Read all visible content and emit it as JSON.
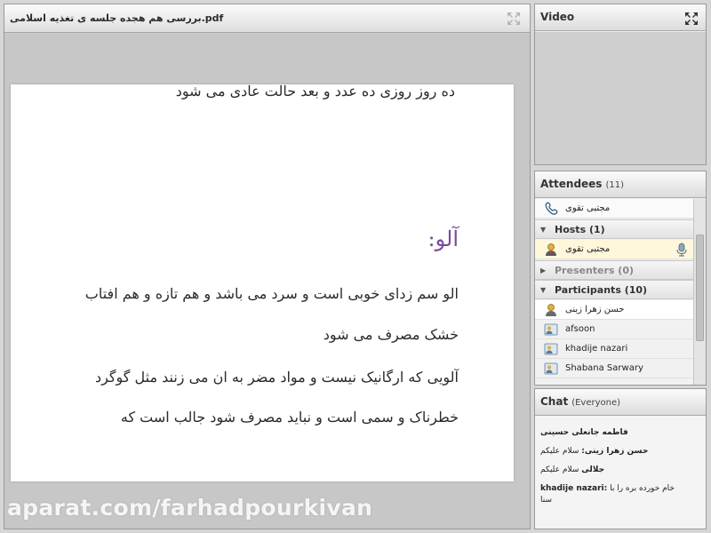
{
  "document": {
    "title": "بررسی هم هجده جلسه ی تغذیه اسلامی.pdf",
    "lines": {
      "top": "ده روز روزی ده عدد و بعد  حالت عادی می شود",
      "heading": "آلو:",
      "para1_l1": "الو سم زدای خوبی است و سرد می باشد و هم تازه و هم افتاب",
      "para1_l2": "خشک مصرف می شود",
      "para2_l1": "آلویی که ارگانیک نیست و مواد مضر به ان می زنند مثل گوگرد",
      "para2_l2": "خطرناک و سمی است و نباید مصرف شود  جالب است که"
    },
    "watermark": "aparat.com/farhadpourkivan"
  },
  "video": {
    "title": "Video"
  },
  "attendees": {
    "title": "Attendees",
    "count": "(11)",
    "top_user": "مجتبی تقوی",
    "hosts_label": "Hosts (1)",
    "host_name": "مجتبی تقوی",
    "presenters_label": "Presenters (0)",
    "participants_label": "Participants (10)",
    "participants": [
      "حسن زهرا زینی",
      "afsoon",
      "khadije nazari",
      "Shabana Sarwary"
    ]
  },
  "chat": {
    "title": "Chat",
    "scope": "(Everyone)",
    "messages": [
      {
        "sender": "فاطمه جانعلی حسینی",
        "text": ""
      },
      {
        "sender": "حسن زهرا زینی:",
        "text": "سلام علیکم"
      },
      {
        "sender": "جلالی",
        "text": "سلام علیکم"
      },
      {
        "sender": "khadije nazari:",
        "text": "خام خورده بره را با"
      },
      {
        "sender": "",
        "text": "سنا"
      }
    ]
  },
  "colors": {
    "heading": "#7a4aa0",
    "pod_bg": "#ececec",
    "page_bg": "#ffffff"
  }
}
